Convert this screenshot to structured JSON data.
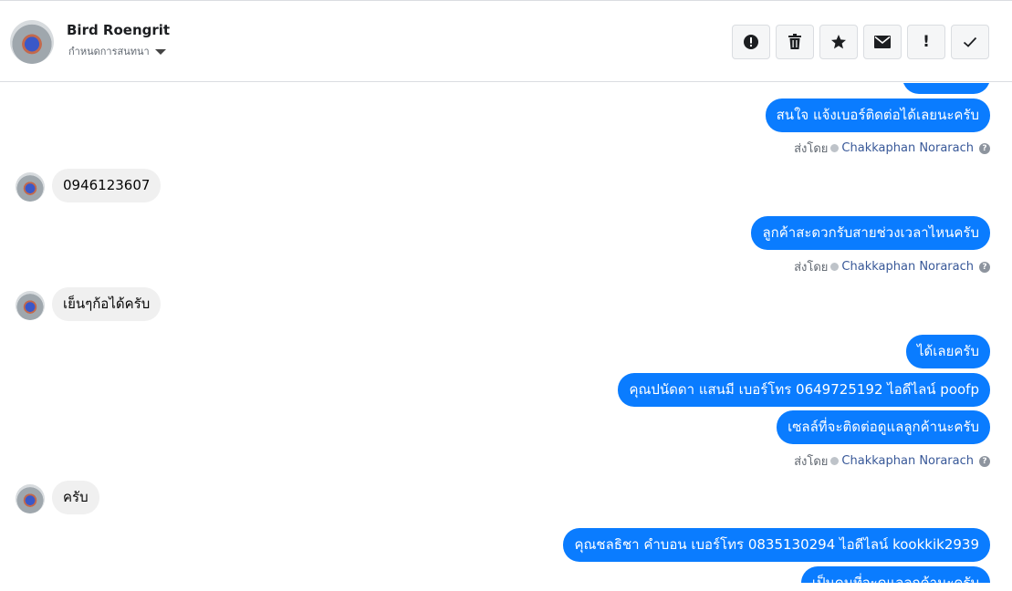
{
  "header": {
    "contact_name": "Bird Roengrit",
    "assign_label": "กำหนดการสนทนา"
  },
  "toolbar": {
    "icons": [
      "alert-circle-icon",
      "trash-icon",
      "star-icon",
      "envelope-icon",
      "exclamation-icon",
      "check-icon"
    ],
    "exclamation_glyph": "!"
  },
  "thread": {
    "sent_by_label": "ส่งโดย",
    "sender_name": "Chakkaphan Norarach",
    "messages": [
      {
        "dir": "out",
        "text": ""
      },
      {
        "dir": "out",
        "text": "สนใจ แจ้งเบอร์ติดต่อได้เลยนะครับ"
      },
      {
        "dir": "in",
        "text": "0946123607"
      },
      {
        "dir": "out",
        "text": "ลูกค้าสะดวกรับสายช่วงเวลาไหนครับ"
      },
      {
        "dir": "in",
        "text": "เย็นๆก้อได้ครับ"
      },
      {
        "dir": "out",
        "text": "ได้เลยครับ"
      },
      {
        "dir": "out",
        "text": "คุณปนัดดา แสนมี   เบอร์โทร 0649725192  ไอดีไลน์ poofp"
      },
      {
        "dir": "out",
        "text": "เซลล์ที่จะติดต่อดูแลลูกค้านะครับ"
      },
      {
        "dir": "in",
        "text": "ครับ"
      },
      {
        "dir": "out",
        "text": "คุณชลธิชา คำบอน เบอร์โทร 0835130294  ไอดีไลน์ kookkik2939"
      },
      {
        "dir": "out",
        "text": "เป็นคนที่จะดูแลลูกค้านะครับ"
      }
    ]
  },
  "colors": {
    "outgoing_bubble": "#0a7cff",
    "incoming_bubble": "#f0f0f0",
    "sender_link": "#385898"
  }
}
